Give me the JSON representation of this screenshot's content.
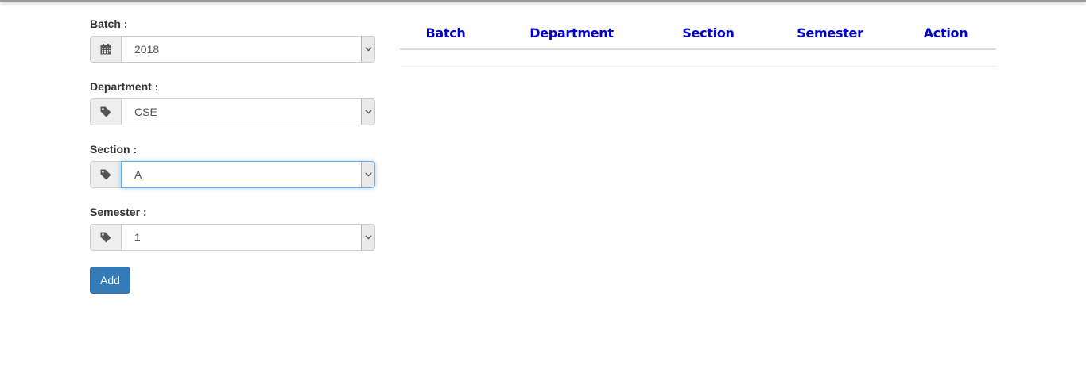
{
  "form": {
    "batch": {
      "label": "Batch :",
      "value": "2018",
      "icon": "calendar-icon"
    },
    "department": {
      "label": "Department :",
      "value": "CSE",
      "icon": "tag-icon"
    },
    "section": {
      "label": "Section :",
      "value": "A",
      "icon": "tag-icon",
      "focused": true
    },
    "semester": {
      "label": "Semester :",
      "value": "1",
      "icon": "tag-icon"
    },
    "add_button": "Add"
  },
  "table": {
    "headers": [
      "Batch",
      "Department",
      "Section",
      "Semester",
      "Action"
    ],
    "rows": []
  },
  "colors": {
    "header_text": "#0000cc",
    "button_bg": "#337ab7",
    "focus_border": "#66afe9"
  }
}
